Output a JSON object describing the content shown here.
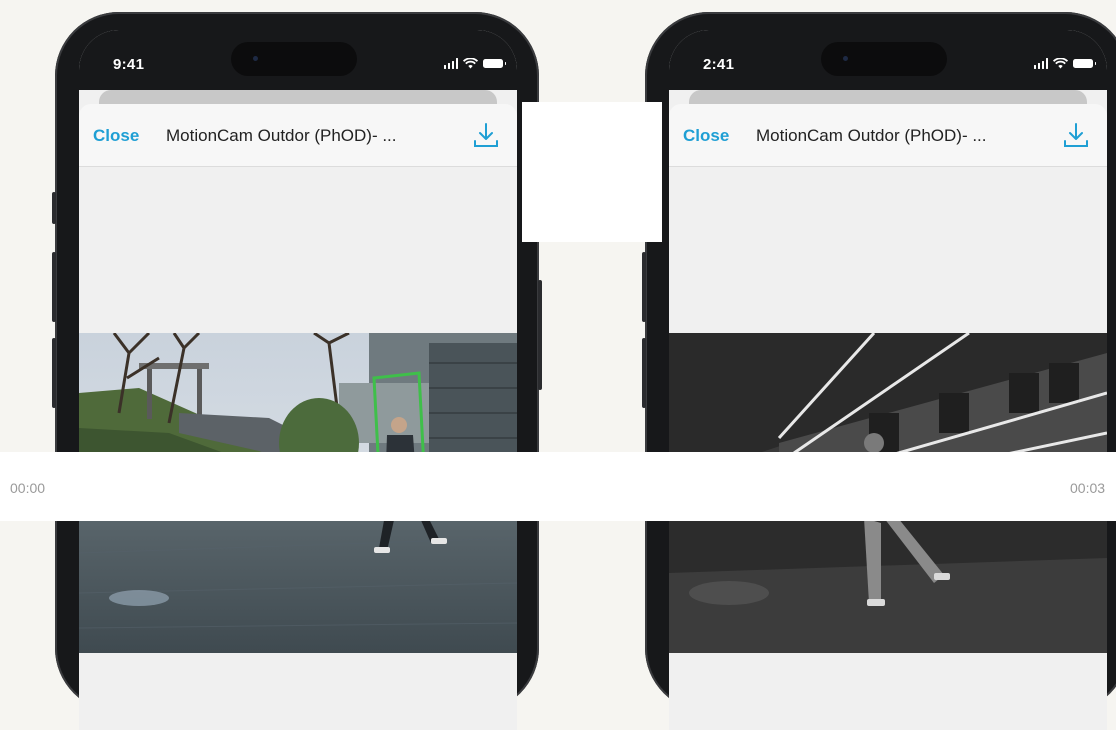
{
  "phones": [
    {
      "time": "9:41",
      "close_label": "Close",
      "title": "MotionCam Outdor (PhOD)- ...",
      "download_icon": "download-icon",
      "video_mode": "color"
    },
    {
      "time": "2:41",
      "close_label": "Close",
      "title": "MotionCam Outdor (PhOD)- ...",
      "download_icon": "download-icon",
      "video_mode": "night-infrared"
    }
  ],
  "timeline": {
    "left_label": "00:00",
    "right_label": "00:03"
  },
  "colors": {
    "accent": "#1f9fd4",
    "frame": "#17181a",
    "screen_bg": "#f0f0f0",
    "page_bg": "#f6f5f1"
  }
}
